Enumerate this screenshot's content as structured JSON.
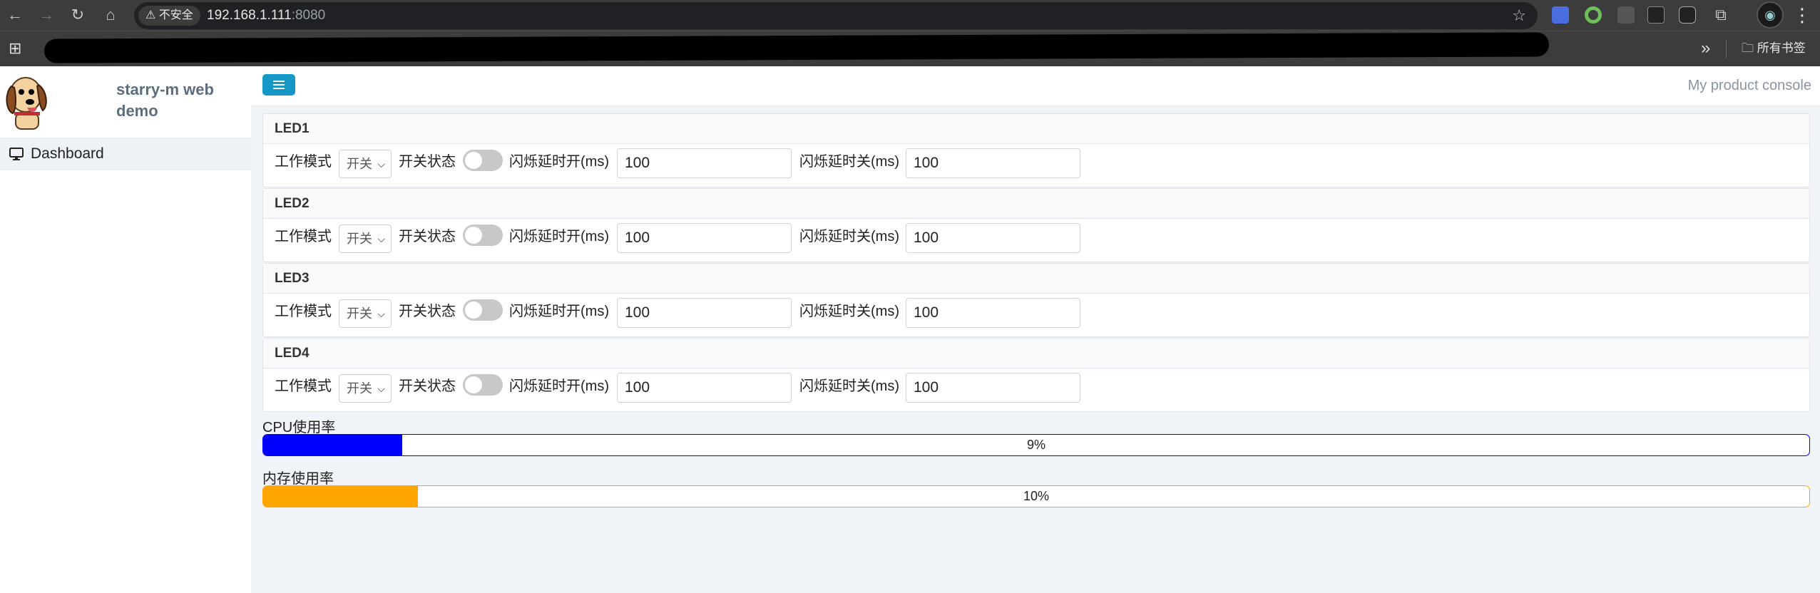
{
  "browser": {
    "security_label": "⚠ 不安全",
    "url_host": "192.168.1.111",
    "url_port": ":8080",
    "bookmarks_all": "所有书签"
  },
  "sidebar": {
    "brand": "starry-m web demo",
    "items": [
      {
        "label": "Dashboard",
        "icon": "monitor-icon",
        "active": true
      }
    ]
  },
  "header": {
    "title": "My product console",
    "menu_icon": "hamburger-icon"
  },
  "leds": [
    {
      "name": "LED1",
      "mode_label": "工作模式",
      "mode_value": "开关",
      "switch_label": "开关状态",
      "switch_on": false,
      "on_delay_label": "闪烁延时开(ms)",
      "on_delay": "100",
      "off_delay_label": "闪烁延时关(ms)",
      "off_delay": "100"
    },
    {
      "name": "LED2",
      "mode_label": "工作模式",
      "mode_value": "开关",
      "switch_label": "开关状态",
      "switch_on": false,
      "on_delay_label": "闪烁延时开(ms)",
      "on_delay": "100",
      "off_delay_label": "闪烁延时关(ms)",
      "off_delay": "100"
    },
    {
      "name": "LED3",
      "mode_label": "工作模式",
      "mode_value": "开关",
      "switch_label": "开关状态",
      "switch_on": false,
      "on_delay_label": "闪烁延时开(ms)",
      "on_delay": "100",
      "off_delay_label": "闪烁延时关(ms)",
      "off_delay": "100"
    },
    {
      "name": "LED4",
      "mode_label": "工作模式",
      "mode_value": "开关",
      "switch_label": "开关状态",
      "switch_on": false,
      "on_delay_label": "闪烁延时开(ms)",
      "on_delay": "100",
      "off_delay_label": "闪烁延时关(ms)",
      "off_delay": "100"
    }
  ],
  "metrics": {
    "cpu": {
      "label": "CPU使用率",
      "value_text": "9%",
      "percent": 9,
      "color": "#0000ff"
    },
    "memory": {
      "label": "内存使用率",
      "value_text": "10%",
      "percent": 10,
      "color": "#ffa500"
    }
  },
  "colors": {
    "accent": "#1598c7",
    "sidebar_active_bg": "#eef2f6",
    "page_bg": "#f0f3f7"
  }
}
